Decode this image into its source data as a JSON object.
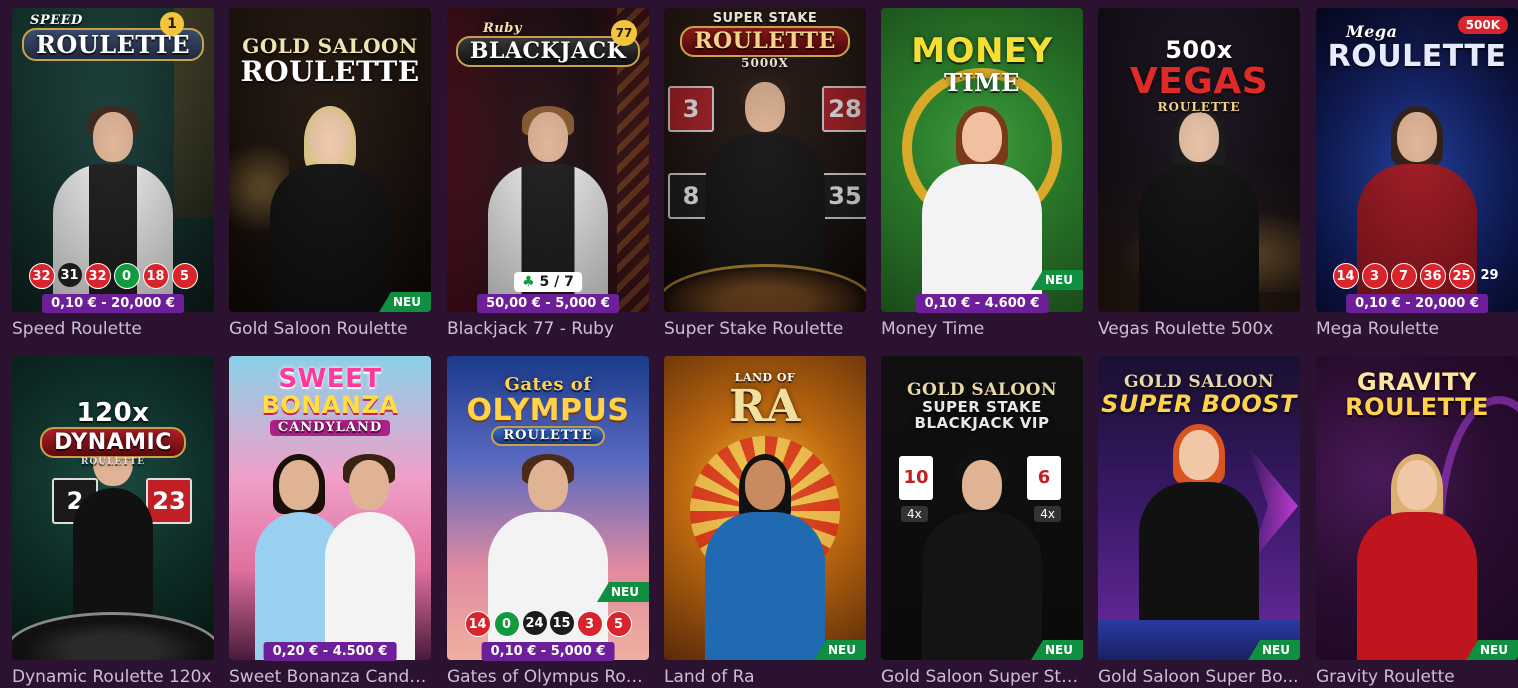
{
  "colors": {
    "page_bg": "#2a1230",
    "limit_pill": "#6d1f9a",
    "new_badge": "#0f8f3f",
    "title_text": "#c9c1cf",
    "red": "#d9242b",
    "green": "#129a3e"
  },
  "games": [
    {
      "title": "Speed Roulette",
      "logo": [
        "SPEED",
        "ROULETTE"
      ],
      "limits": "0,10 € - 20,000 €",
      "results": [
        {
          "v": "32",
          "c": "red"
        },
        {
          "v": "31",
          "c": "black"
        },
        {
          "v": "32",
          "c": "red"
        },
        {
          "v": "0",
          "c": "green"
        },
        {
          "v": "18",
          "c": "red"
        },
        {
          "v": "5",
          "c": "red"
        }
      ],
      "corner_number": "1"
    },
    {
      "title": "Gold Saloon Roulette",
      "logo": [
        "GOLD SALOON",
        "ROULETTE"
      ],
      "new": "NEU"
    },
    {
      "title": "Blackjack 77 - Ruby",
      "logo": [
        "Ruby",
        "BLACKJACK"
      ],
      "limits": "50,00 € - 5,000 €",
      "seats": "5 / 7",
      "corner_number": "77"
    },
    {
      "title": "Super Stake Roulette",
      "logo": [
        "SUPER STAKE",
        "ROULETTE",
        "5000X"
      ],
      "tiles": [
        "3",
        "28",
        "8",
        "35"
      ]
    },
    {
      "title": "Money Time",
      "logo": [
        "MONEY",
        "TIME"
      ],
      "limits": "0,10 € - 4.600 €",
      "new": "NEU"
    },
    {
      "title": "Vegas Roulette 500x",
      "logo": [
        "500x",
        "VEGAS",
        "ROULETTE"
      ]
    },
    {
      "title": "Mega Roulette",
      "logo": [
        "Mega",
        "ROULETTE"
      ],
      "limits": "0,10 € - 20,000 €",
      "results": [
        {
          "v": "14",
          "c": "red"
        },
        {
          "v": "3",
          "c": "red"
        },
        {
          "v": "7",
          "c": "red"
        },
        {
          "v": "36",
          "c": "red"
        },
        {
          "v": "25",
          "c": "red"
        },
        {
          "v": "29",
          "c": "plain"
        }
      ],
      "corner_number": "500K"
    },
    {
      "title": "Dynamic Roulette 120x",
      "logo": [
        "120x",
        "DYNAMIC",
        "ROULETTE"
      ],
      "tiles": [
        "2",
        "23"
      ]
    },
    {
      "title": "Sweet Bonanza Candy...",
      "logo": [
        "SWEET",
        "BONANZA",
        "CANDYLAND"
      ],
      "limits": "0,20 € - 4.500 €"
    },
    {
      "title": "Gates of Olympus Rou...",
      "logo": [
        "Gates of",
        "OLYMPUS",
        "ROULETTE"
      ],
      "limits": "0,10 € - 5,000 €",
      "new": "NEU",
      "results": [
        {
          "v": "14",
          "c": "red"
        },
        {
          "v": "0",
          "c": "green"
        },
        {
          "v": "24",
          "c": "black"
        },
        {
          "v": "15",
          "c": "black"
        },
        {
          "v": "3",
          "c": "red"
        },
        {
          "v": "5",
          "c": "red"
        }
      ]
    },
    {
      "title": "Land of Ra",
      "logo": [
        "LAND OF",
        "RA"
      ],
      "new": "NEU"
    },
    {
      "title": "Gold Saloon Super Sta...",
      "logo": [
        "GOLD SALOON",
        "SUPER STAKE",
        "BLACKJACK VIP"
      ],
      "new": "NEU",
      "cards": [
        "10",
        "6"
      ],
      "multipliers": [
        "4x",
        "4x"
      ]
    },
    {
      "title": "Gold Saloon Super Bo...",
      "logo": [
        "GOLD SALOON",
        "SUPER BOOST"
      ],
      "new": "NEU"
    },
    {
      "title": "Gravity Roulette",
      "logo": [
        "GRAVITY",
        "ROULETTE"
      ],
      "new": "NEU"
    }
  ]
}
